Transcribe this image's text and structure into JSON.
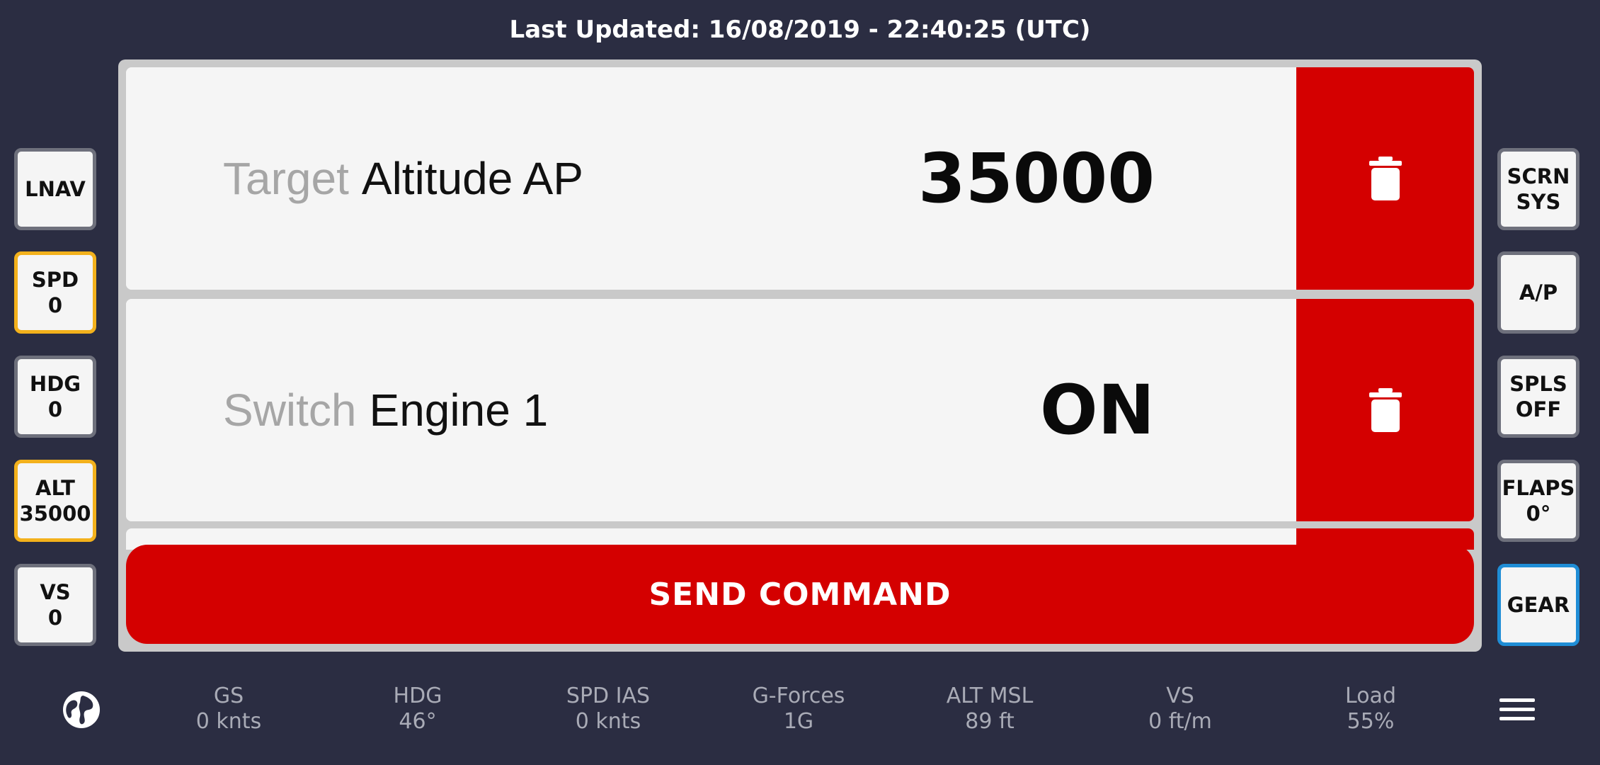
{
  "header": {
    "last_updated": "Last Updated: 16/08/2019 - 22:40:25 (UTC)"
  },
  "left_buttons": [
    {
      "line1": "LNAV",
      "line2": ""
    },
    {
      "line1": "SPD",
      "line2": "0"
    },
    {
      "line1": "HDG",
      "line2": "0"
    },
    {
      "line1": "ALT",
      "line2": "35000"
    },
    {
      "line1": "VS",
      "line2": "0"
    }
  ],
  "right_buttons": [
    {
      "line1": "SCRN",
      "line2": "SYS"
    },
    {
      "line1": "A/P",
      "line2": ""
    },
    {
      "line1": "SPLS",
      "line2": "OFF"
    },
    {
      "line1": "FLAPS",
      "line2": "0°"
    },
    {
      "line1": "GEAR",
      "line2": ""
    }
  ],
  "commands": [
    {
      "prefix": "Target",
      "label": "Altitude AP",
      "value": "35000",
      "delete_icon": "trash-icon"
    },
    {
      "prefix": "Switch",
      "label": "Engine 1",
      "value": "ON",
      "delete_icon": "trash-icon"
    }
  ],
  "send_button": {
    "label": "SEND COMMAND"
  },
  "footer": {
    "globe_icon": "globe-icon",
    "menu_icon": "menu-icon",
    "stats": [
      {
        "label": "GS",
        "value": "0 knts"
      },
      {
        "label": "HDG",
        "value": "46°"
      },
      {
        "label": "SPD IAS",
        "value": "0 knts"
      },
      {
        "label": "G-Forces",
        "value": "1G"
      },
      {
        "label": "ALT MSL",
        "value": "89 ft"
      },
      {
        "label": "VS",
        "value": "0 ft/m"
      },
      {
        "label": "Load",
        "value": "55%"
      }
    ]
  },
  "colors": {
    "background": "#2b2d42",
    "accent_red": "#d40000",
    "active_orange": "#f3b11c",
    "active_blue": "#1f8dd6",
    "panel": "#f5f5f5"
  }
}
